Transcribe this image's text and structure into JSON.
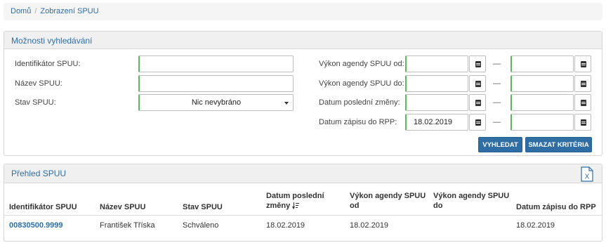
{
  "breadcrumb": {
    "home": "Domů",
    "separator": "/",
    "current": "Zobrazení SPUU"
  },
  "search": {
    "title": "Možnosti vyhledávání",
    "fields": {
      "identifier_label": "Identifikátor SPUU:",
      "name_label": "Název SPUU:",
      "state_label": "Stav SPUU:",
      "state_value": "Nic nevybráno",
      "perf_from_label": "Výkon agendy SPUU od:",
      "perf_to_label": "Výkon agendy SPUU do:",
      "last_change_label": "Datum poslední změny:",
      "record_date_label": "Datum zápisu do RPP:",
      "record_date_from_value": "18.02.2019",
      "range_dash": "—"
    },
    "buttons": {
      "search": "VYHLEDAT",
      "clear": "SMAZAT KRITÉRIA"
    }
  },
  "overview": {
    "title": "Přehled SPUU",
    "export_icon": "excel-export-icon",
    "columns": {
      "identifier": "Identifikátor SPUU",
      "name": "Název SPUU",
      "state": "Stav SPUU",
      "last_change_line1": "Datum poslední",
      "last_change_line2": "změny",
      "perf_from_line1": "Výkon agendy SPUU",
      "perf_from_line2": "od",
      "perf_to_line1": "Výkon agendy SPUU",
      "perf_to_line2": "do",
      "record_date": "Datum zápisu do RPP"
    },
    "rows": [
      {
        "identifier": "00830500.9999",
        "name": "František Tříska",
        "state": "Schváleno",
        "last_change": "18.02.2019",
        "perf_from": "18.02.2019",
        "perf_to": "",
        "record_date": "18.02.2019"
      }
    ]
  },
  "colors": {
    "accent": "#2f6ea5",
    "required_border": "#5cb85c",
    "panel_header": "#f0f0f0"
  }
}
